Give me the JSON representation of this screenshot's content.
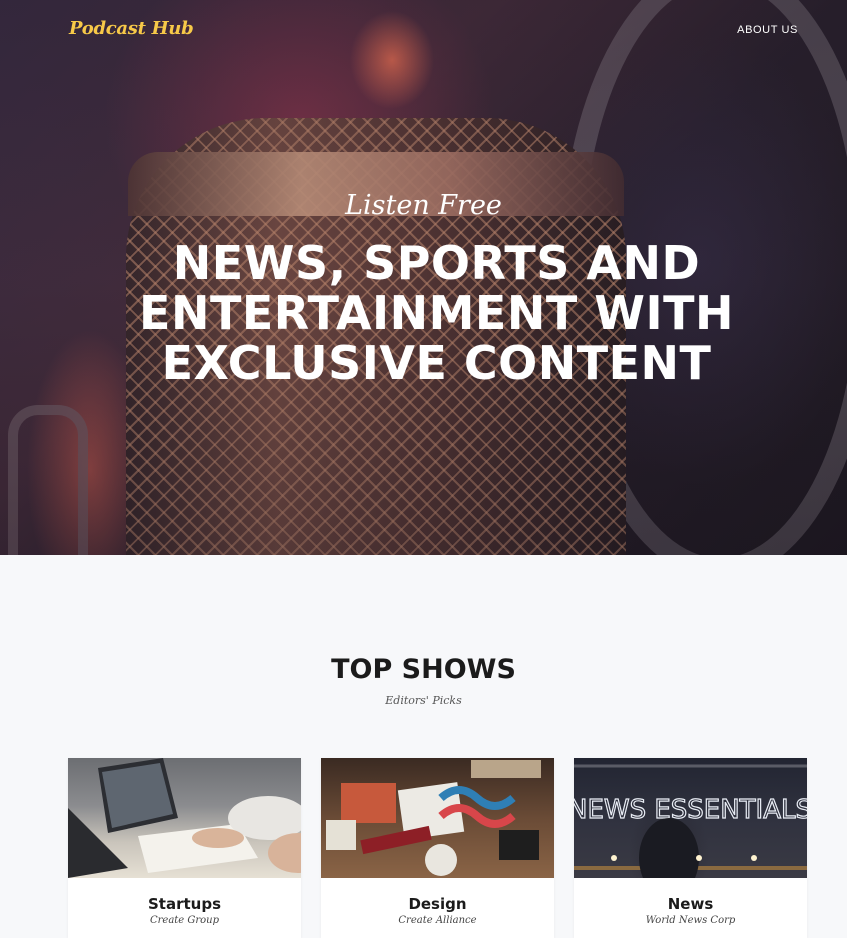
{
  "header": {
    "brand": "Podcast Hub",
    "nav": {
      "about_label": "ABOUT US"
    }
  },
  "hero": {
    "subtitle": "Listen Free",
    "title": "NEWS, SPORTS AND ENTERTAINMENT WITH EXCLUSIVE CONTENT"
  },
  "top_shows": {
    "title": "TOP SHOWS",
    "subtitle": "Editors' Picks",
    "shows": [
      {
        "name": "Startups",
        "author": "Create Group"
      },
      {
        "name": "Design",
        "author": "Create Alliance"
      },
      {
        "name": "News",
        "author": "World News Corp"
      }
    ]
  },
  "images": {
    "news_sign": "NEWS ESSENTIALS"
  },
  "colors": {
    "brand": "#f7c948",
    "page_bg": "#f7f8fa",
    "card_bg": "#ffffff",
    "heading": "#1b1b1b"
  }
}
